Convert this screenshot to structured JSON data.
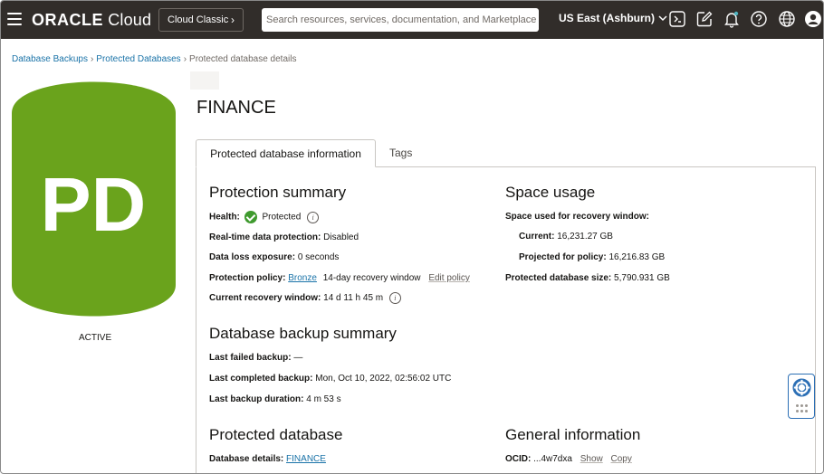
{
  "header": {
    "logo_brand": "ORACLE",
    "logo_product": " Cloud",
    "classic_label": "Cloud Classic",
    "search_placeholder": "Search resources, services, documentation, and Marketplace",
    "region": "US East (Ashburn)",
    "icons": [
      "menu-icon",
      "cloud-shell-icon",
      "edit-icon",
      "bell-icon",
      "help-icon",
      "globe-icon",
      "user-icon"
    ]
  },
  "breadcrumb": {
    "item1": "Database Backups",
    "item2": "Protected Databases",
    "current": "Protected database details",
    "separator": "›"
  },
  "badge": {
    "initials": "PD",
    "status": "ACTIVE",
    "color": "#6aa31c"
  },
  "page": {
    "title": "FINANCE"
  },
  "tabs": {
    "active": "Protected database information",
    "other": "Tags"
  },
  "protection_summary": {
    "heading": "Protection summary",
    "health_label": "Health:",
    "health_value": "Protected",
    "rt_label": "Real-time data protection:",
    "rt_value": "Disabled",
    "dle_label": "Data loss exposure:",
    "dle_value": "0 seconds",
    "policy_label": "Protection policy:",
    "policy_link": "Bronze",
    "policy_window": "14-day recovery window",
    "policy_edit": "Edit policy",
    "crw_label": "Current recovery window:",
    "crw_value": "14 d 11 h 45 m"
  },
  "space_usage": {
    "heading": "Space usage",
    "used_label": "Space used for recovery window:",
    "current_label": "Current:",
    "current_value": "16,231.27 GB",
    "projected_label": "Projected for policy:",
    "projected_value": "16,216.83 GB",
    "size_label": "Protected database size:",
    "size_value": "5,790.931 GB"
  },
  "backup_summary": {
    "heading": "Database backup summary",
    "failed_label": "Last failed backup:",
    "failed_value": "—",
    "completed_label": "Last completed backup:",
    "completed_value": "Mon, Oct 10, 2022, 02:56:02 UTC",
    "duration_label": "Last backup duration:",
    "duration_value": "4 m 53 s"
  },
  "protected_database": {
    "heading": "Protected database",
    "details_label": "Database details:",
    "details_link": "FINANCE"
  },
  "general_information": {
    "heading": "General information",
    "ocid_label": "OCID:",
    "ocid_value": "...4w7dxa",
    "show": "Show",
    "copy": "Copy"
  }
}
